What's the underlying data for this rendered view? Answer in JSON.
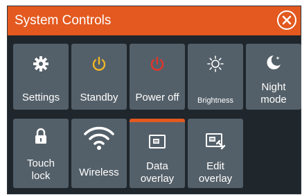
{
  "window": {
    "title": "System Controls"
  },
  "colors": {
    "accent": "#e3591f",
    "tile": "#546069",
    "background": "#1f262c",
    "standby_icon": "#f0b528",
    "power_icon": "#e5332a"
  },
  "tiles": [
    {
      "label": "Settings",
      "icon": "gear-icon"
    },
    {
      "label": "Standby",
      "icon": "standby-icon"
    },
    {
      "label": "Power off",
      "icon": "power-icon"
    },
    {
      "label": "Brightness",
      "icon": "brightness-icon"
    },
    {
      "label": "Night\nmode",
      "icon": "moon-icon"
    },
    {
      "label": "Touch\nlock",
      "icon": "lock-icon"
    },
    {
      "label": "Wireless",
      "icon": "wifi-icon"
    },
    {
      "label": "Data\noverlay",
      "icon": "data-overlay-icon",
      "active": true
    },
    {
      "label": "Edit\noverlay",
      "icon": "edit-overlay-icon"
    }
  ]
}
